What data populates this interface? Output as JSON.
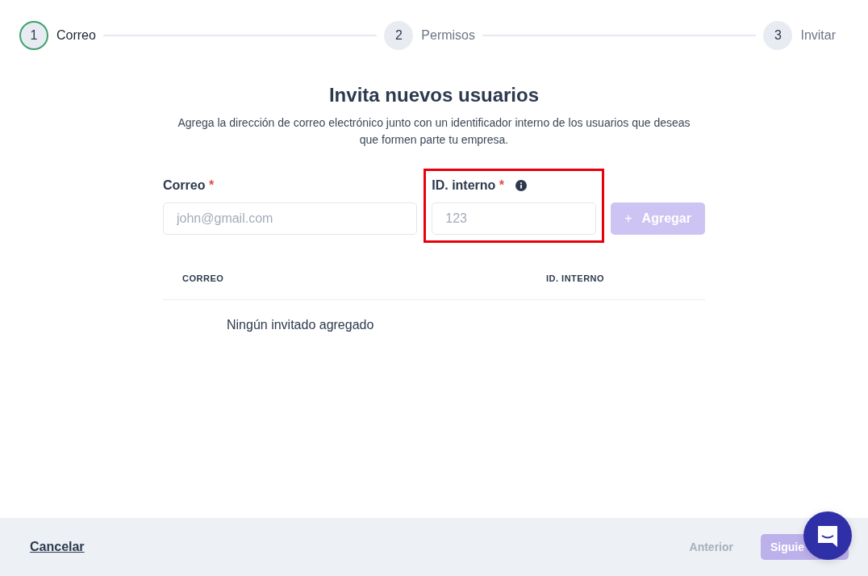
{
  "steps": [
    {
      "number": "1",
      "label": "Correo",
      "selected": true
    },
    {
      "number": "2",
      "label": "Permisos",
      "selected": false
    },
    {
      "number": "3",
      "label": "Invitar",
      "selected": false
    }
  ],
  "title": "Invita nuevos usuarios",
  "description": "Agrega la dirección de correo electrónico junto con un identificador interno de los usuarios que deseas que formen parte tu empresa.",
  "fields": [
    {
      "label": "Correo",
      "required": "*",
      "placeholder": "john@gmail.com",
      "info": false,
      "highlighted": false
    },
    {
      "label": "ID. interno",
      "required": "*",
      "placeholder": "123",
      "info": true,
      "highlighted": true
    }
  ],
  "add_button": {
    "icon": "+",
    "label": "Agregar",
    "disabled": true
  },
  "table": {
    "columns": [
      "CORREO",
      "ID. INTERNO"
    ],
    "empty_message": "Ningún invitado agregado"
  },
  "footer": {
    "cancel": "Cancelar",
    "previous": {
      "label": "Anterior",
      "disabled": true
    },
    "next": {
      "label": "Siguie",
      "disabled": true
    }
  }
}
